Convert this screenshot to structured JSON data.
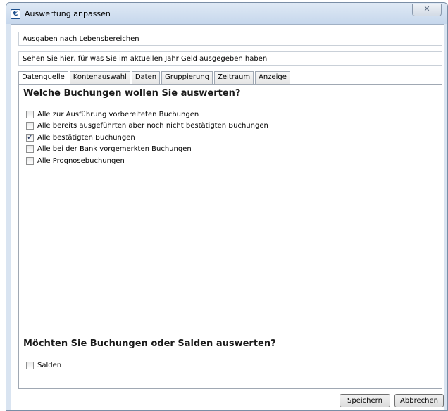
{
  "window": {
    "title": "Auswertung anpassen",
    "icon_glyph": "€",
    "close_glyph": "✕"
  },
  "fields": {
    "name_value": "Ausgaben nach Lebensbereichen",
    "description_value": "Sehen Sie hier, für was Sie im aktuellen Jahr Geld ausgegeben haben"
  },
  "tabs": [
    {
      "label": "Datenquelle",
      "active": true
    },
    {
      "label": "Kontenauswahl",
      "active": false
    },
    {
      "label": "Daten",
      "active": false
    },
    {
      "label": "Gruppierung",
      "active": false
    },
    {
      "label": "Zeitraum",
      "active": false
    },
    {
      "label": "Anzeige",
      "active": false
    }
  ],
  "panel": {
    "heading1": "Welche Buchungen wollen Sie auswerten?",
    "options": [
      {
        "label": "Alle zur Ausführung vorbereiteten Buchungen",
        "checked": false
      },
      {
        "label": "Alle bereits ausgeführten aber noch nicht bestätigten Buchungen",
        "checked": false
      },
      {
        "label": "Alle bestätigten Buchungen",
        "checked": true
      },
      {
        "label": "Alle bei der Bank vorgemerkten Buchungen",
        "checked": false
      },
      {
        "label": "Alle Prognosebuchungen",
        "checked": false
      }
    ],
    "heading2": "Möchten Sie Buchungen oder Salden auswerten?",
    "salden": {
      "label": "Salden",
      "checked": false
    }
  },
  "footer": {
    "save_label": "Speichern",
    "cancel_label": "Abbrechen"
  }
}
